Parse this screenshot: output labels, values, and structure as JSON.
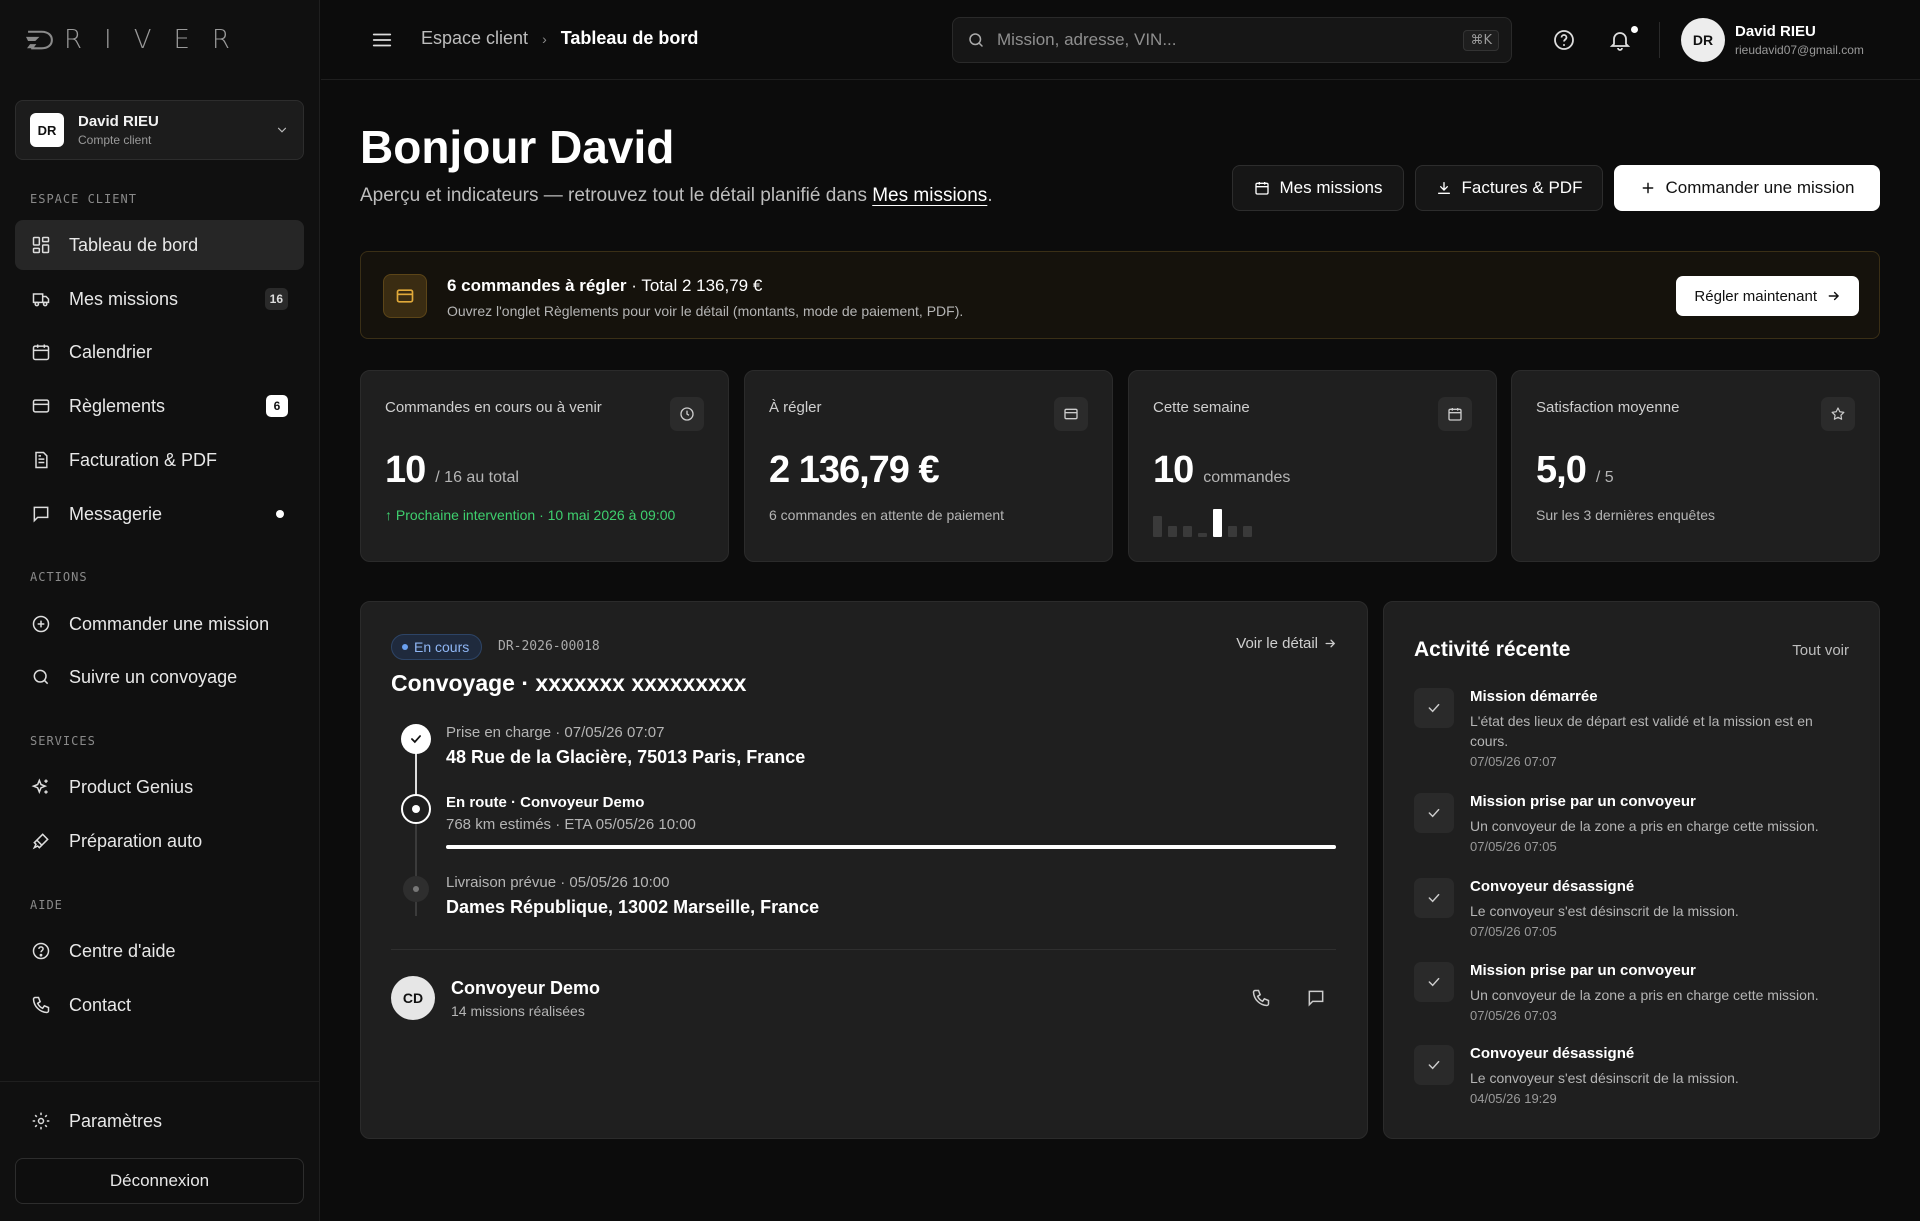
{
  "brand": {
    "logo_letters": [
      "R",
      "I",
      "V",
      "E",
      "R"
    ]
  },
  "account": {
    "initials": "DR",
    "name": "David RIEU",
    "role": "Compte client"
  },
  "sidebar": {
    "section_client": "ESPACE CLIENT",
    "items_client": [
      {
        "label": "Tableau de bord",
        "icon": "dashboard-icon"
      },
      {
        "label": "Mes missions",
        "icon": "truck-icon",
        "badge": "16"
      },
      {
        "label": "Calendrier",
        "icon": "calendar-icon"
      },
      {
        "label": "Règlements",
        "icon": "card-icon",
        "badge": "6"
      },
      {
        "label": "Facturation & PDF",
        "icon": "document-icon"
      },
      {
        "label": "Messagerie",
        "icon": "message-icon"
      }
    ],
    "section_actions": "ACTIONS",
    "items_actions": [
      {
        "label": "Commander une mission",
        "icon": "plus-circle-icon"
      },
      {
        "label": "Suivre un convoyage",
        "icon": "search-icon"
      }
    ],
    "section_services": "SERVICES",
    "items_services": [
      {
        "label": "Product Genius",
        "icon": "sparkle-icon"
      },
      {
        "label": "Préparation auto",
        "icon": "brush-icon"
      }
    ],
    "section_help": "AIDE",
    "items_help": [
      {
        "label": "Centre d'aide",
        "icon": "help-icon"
      },
      {
        "label": "Contact",
        "icon": "phone-icon"
      }
    ],
    "settings": "Paramètres",
    "logout": "Déconnexion"
  },
  "header": {
    "breadcrumb_root": "Espace client",
    "breadcrumb_current": "Tableau de bord",
    "search_placeholder": "Mission, adresse, VIN...",
    "search_shortcut": "⌘K",
    "user_initials": "DR",
    "user_name": "David RIEU",
    "user_email": "rieudavid07@gmail.com"
  },
  "page": {
    "greeting": "Bonjour David",
    "subtitle": "Aperçu et indicateurs — retrouvez tout le détail planifié dans ",
    "subtitle_link": "Mes missions",
    "subtitle_end": ".",
    "btn_missions": "Mes missions",
    "btn_invoices": "Factures & PDF",
    "btn_order": "Commander une mission"
  },
  "alert": {
    "title_bold": "6 commandes à régler",
    "title_rest": " · Total 2 136,79 €",
    "subtitle": "Ouvrez l'onglet Règlements pour voir le détail (montants, mode de paiement, PDF).",
    "action": "Régler maintenant"
  },
  "stats": [
    {
      "label": "Commandes en cours ou à venir",
      "value": "10",
      "suffix": "/ 16 au total",
      "footer": "Prochaine intervention · 10 mai 2026 à 09:00",
      "icon": "clock-icon"
    },
    {
      "label": "À régler",
      "value": "2 136,79 €",
      "suffix": "",
      "footer": "6 commandes en attente de paiement",
      "icon": "card-icon"
    },
    {
      "label": "Cette semaine",
      "value": "10",
      "suffix": "commandes",
      "icon": "calendar-icon",
      "weekly_counts": [
        2,
        1,
        1,
        0,
        10,
        1,
        1
      ]
    },
    {
      "label": "Satisfaction moyenne",
      "value": "5,0",
      "suffix": "/ 5",
      "footer": "Sur les 3 dernières enquêtes",
      "icon": "star-icon"
    }
  ],
  "mission": {
    "status": "En cours",
    "reference": "DR-2026-00018",
    "detail_link": "Voir le détail",
    "title": "Convoyage · xxxxxxx xxxxxxxxx",
    "pickup_meta": "Prise en charge · 07/05/26 07:07",
    "pickup_address": "48 Rue de la Glacière, 75013 Paris, France",
    "route_label": "En route · Convoyeur Demo",
    "route_distance": "768 km estimés",
    "route_eta": "ETA 05/05/26 10:00",
    "route_progress": 1.0,
    "delivery_meta": "Livraison prévue · 05/05/26 10:00",
    "delivery_address": "Dames République, 13002 Marseille, France",
    "driver_initials": "CD",
    "driver_name": "Convoyeur Demo",
    "driver_missions": "14 missions réalisées"
  },
  "activity": {
    "title": "Activité récente",
    "see_all": "Tout voir",
    "items": [
      {
        "name": "Mission démarrée",
        "desc": "L'état des lieux de départ est validé et la mission est en cours.",
        "time": "07/05/26 07:07"
      },
      {
        "name": "Mission prise par un convoyeur",
        "desc": "Un convoyeur de la zone a pris en charge cette mission.",
        "time": "07/05/26 07:05"
      },
      {
        "name": "Convoyeur désassigné",
        "desc": "Le convoyeur s'est désinscrit de la mission.",
        "time": "07/05/26 07:05"
      },
      {
        "name": "Mission prise par un convoyeur",
        "desc": "Un convoyeur de la zone a pris en charge cette mission.",
        "time": "07/05/26 07:03"
      },
      {
        "name": "Convoyeur désassigné",
        "desc": "Le convoyeur s'est désinscrit de la mission.",
        "time": "04/05/26 19:29"
      }
    ]
  }
}
